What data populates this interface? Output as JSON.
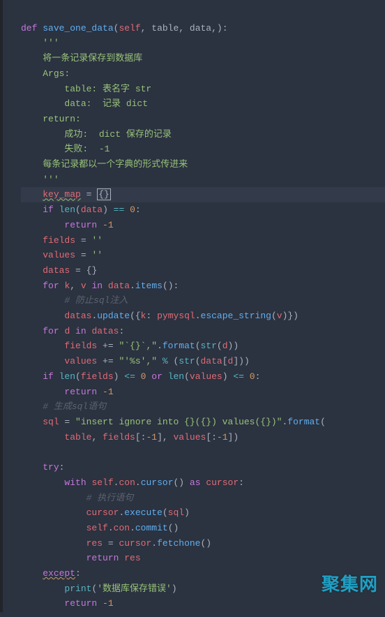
{
  "watermark": "聚集网",
  "code": {
    "l1": {
      "def": "def ",
      "fn": "save_one_data",
      "p": "(",
      "self": "self",
      "c1": ", ",
      "a1": "table",
      "c2": ", ",
      "a2": "data",
      "c3": ",)",
      "colon": ":"
    },
    "l2": "'''",
    "l3": "将一条记录保存到数据库",
    "l4": "Args:",
    "l5": "    table: 表名字 str",
    "l6": "    data:  记录 dict",
    "l7": "return:",
    "l8": "    成功:  dict 保存的记录",
    "l9": "    失败:  -1",
    "l10": "每条记录都以一个字典的形式传进来",
    "l11": "'''",
    "l12": {
      "v": "key_map",
      "eq": " = ",
      "b": "{}"
    },
    "l13": {
      "if": "if ",
      "len": "len",
      "p1": "(",
      "v": "data",
      "p2": ") ",
      "eq": "== ",
      "n": "0",
      "colon": ":"
    },
    "l14": {
      "ret": "return ",
      "n": "-1"
    },
    "l15": {
      "v": "fields",
      "eq": " = ",
      "s": "''"
    },
    "l16": {
      "v": "values",
      "eq": " = ",
      "s": "''"
    },
    "l17": {
      "v": "datas",
      "eq": " = ",
      "b": "{}"
    },
    "l18": {
      "for": "for ",
      "k": "k",
      "c1": ", ",
      "v": "v",
      "in": " in ",
      "d": "data",
      "dot": ".",
      "m": "items",
      "p": "():"
    },
    "l19": "# 防止sql注入",
    "l20": {
      "v": "datas",
      "dot": ".",
      "m": "update",
      "p1": "({",
      "k": "k",
      "c": ": ",
      "mod": "pymysql",
      "dot2": ".",
      "m2": "escape_string",
      "p2": "(",
      "vv": "v",
      "p3": ")})"
    },
    "l21": {
      "for": "for ",
      "d": "d",
      "in": " in ",
      "v": "datas",
      "colon": ":"
    },
    "l22": {
      "v": "fields",
      "pe": " += ",
      "s": "\"`{}`,\"",
      "dot": ".",
      "m": "format",
      "p1": "(",
      "str": "str",
      "p2": "(",
      "d": "d",
      "p3": "))"
    },
    "l23": {
      "v": "values",
      "pe": " += ",
      "s": "\"'%s',\"",
      "pct": " % ",
      "p1": "(",
      "str": "str",
      "p2": "(",
      "d": "data",
      "b1": "[",
      "dd": "d",
      "b2": "]))"
    },
    "l24": {
      "if": "if ",
      "len": "len",
      "p1": "(",
      "f": "fields",
      "p2": ") ",
      "le": "<= ",
      "z": "0",
      "or": " or ",
      "len2": "len",
      "p3": "(",
      "v": "values",
      "p4": ") ",
      "le2": "<= ",
      "z2": "0",
      "colon": ":"
    },
    "l25": {
      "ret": "return ",
      "n": "-1"
    },
    "l26": "# 生成sql语句",
    "l27": {
      "v": "sql",
      "eq": " = ",
      "s": "\"insert ignore into {}({}) values({})\"",
      "dot": ".",
      "m": "format",
      "p": "("
    },
    "l28": {
      "t": "table",
      "c1": ", ",
      "f": "fields",
      "s1": "[:",
      "n1": "-1",
      "s1b": "]",
      "c2": ", ",
      "v": "values",
      "s2": "[:",
      "n2": "-1",
      "s2b": "])"
    },
    "l29": {
      "try": "try",
      "colon": ":"
    },
    "l30": {
      "with": "with ",
      "self": "self",
      "dot": ".",
      "con": "con",
      "dot2": ".",
      "m": "cursor",
      "p": "() ",
      "as": "as ",
      "c": "cursor",
      "colon": ":"
    },
    "l31": "# 执行语句",
    "l32": {
      "c": "cursor",
      "dot": ".",
      "m": "execute",
      "p1": "(",
      "s": "sql",
      "p2": ")"
    },
    "l33": {
      "self": "self",
      "dot": ".",
      "con": "con",
      "dot2": ".",
      "m": "commit",
      "p": "()"
    },
    "l34": {
      "r": "res",
      "eq": " = ",
      "c": "cursor",
      "dot": ".",
      "m": "fetchone",
      "p": "()"
    },
    "l35": {
      "ret": "return ",
      "r": "res"
    },
    "l36": {
      "exc": "except",
      "colon": ":"
    },
    "l37": {
      "p": "print",
      "p1": "(",
      "s": "'数据库保存错误'",
      "p2": ")"
    },
    "l38": {
      "ret": "return ",
      "n": "-1"
    }
  }
}
